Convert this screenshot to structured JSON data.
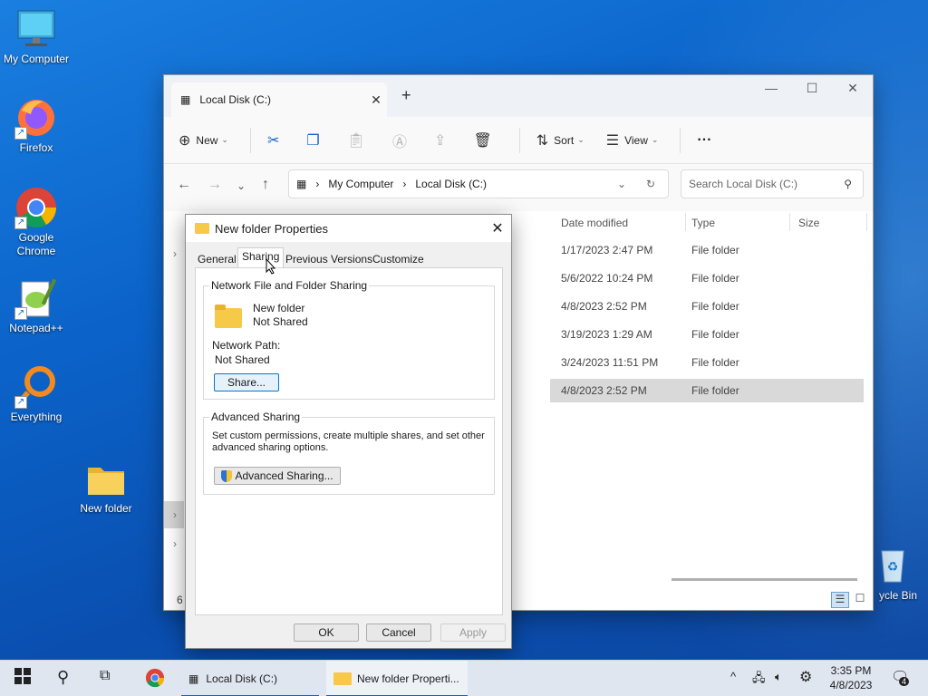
{
  "desktop": {
    "icons": [
      {
        "label": "My Computer",
        "icon": "monitor-icon"
      },
      {
        "label": "Firefox",
        "icon": "firefox-icon"
      },
      {
        "label": "Google Chrome",
        "icon": "chrome-icon"
      },
      {
        "label": "Notepad++",
        "icon": "notepadpp-icon"
      },
      {
        "label": "Everything",
        "icon": "everything-icon"
      },
      {
        "label": "New folder",
        "icon": "folder-icon"
      },
      {
        "label": "ycle Bin",
        "icon": "recycle-bin-icon"
      }
    ]
  },
  "explorer": {
    "tab_title": "Local Disk (C:)",
    "toolbar": {
      "new_label": "New",
      "sort_label": "Sort",
      "view_label": "View",
      "more_label": "···"
    },
    "address": {
      "crumbs": [
        "My Computer",
        "Local Disk (C:)"
      ]
    },
    "search_placeholder": "Search Local Disk (C:)",
    "columns": [
      "Date modified",
      "Type",
      "Size"
    ],
    "rows": [
      {
        "date": "1/17/2023 2:47 PM",
        "type": "File folder"
      },
      {
        "date": "5/6/2022 10:24 PM",
        "type": "File folder"
      },
      {
        "date": "4/8/2023 2:52 PM",
        "type": "File folder"
      },
      {
        "date": "3/19/2023 1:29 AM",
        "type": "File folder"
      },
      {
        "date": "3/24/2023 11:51 PM",
        "type": "File folder"
      },
      {
        "date": "4/8/2023 2:52 PM",
        "type": "File folder",
        "selected": true
      }
    ],
    "status_count": "6"
  },
  "dialog": {
    "title": "New folder Properties",
    "tabs": [
      "General",
      "Sharing",
      "Previous Versions",
      "Customize"
    ],
    "active_tab": "Sharing",
    "network_group_title": "Network File and Folder Sharing",
    "folder_name": "New folder",
    "folder_status": "Not Shared",
    "network_path_label": "Network Path:",
    "network_path_value": "Not Shared",
    "share_button": "Share...",
    "advanced_group_title": "Advanced Sharing",
    "advanced_desc_line1": "Set custom permissions, create multiple shares, and set other",
    "advanced_desc_line2": "advanced sharing options.",
    "advanced_button": "Advanced Sharing...",
    "ok": "OK",
    "cancel": "Cancel",
    "apply": "Apply"
  },
  "taskbar": {
    "apps": [
      {
        "label": "Local Disk (C:)"
      },
      {
        "label": "New folder Properti..."
      }
    ],
    "time": "3:35 PM",
    "date": "4/8/2023",
    "notification_count": "4"
  },
  "colors": {
    "accent": "#0a64c8",
    "folder": "#f7c948",
    "selection": "#d9d9d9"
  }
}
